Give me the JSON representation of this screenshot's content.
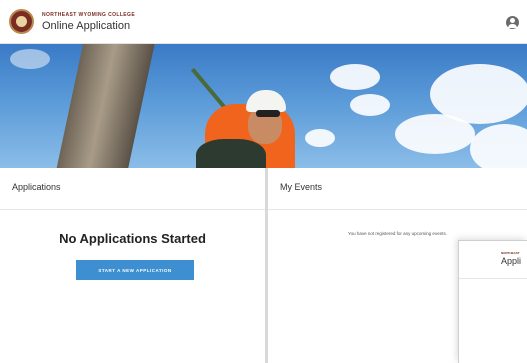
{
  "header": {
    "college_name": "NORTHEAST WYOMING COLLEGE",
    "app_title": "Online Application",
    "user_icon": "user-circle-icon"
  },
  "applications": {
    "heading": "Applications",
    "empty_message": "No Applications Started",
    "start_button_label": "START A NEW APPLICATION"
  },
  "events": {
    "heading": "My Events",
    "empty_message": "You have not registered for any upcoming events."
  },
  "overlay": {
    "college_name": "NORTHEAST",
    "app_title": "Appli"
  },
  "colors": {
    "accent_blue": "#3d8fd1",
    "brand_maroon": "#7a2c22"
  }
}
